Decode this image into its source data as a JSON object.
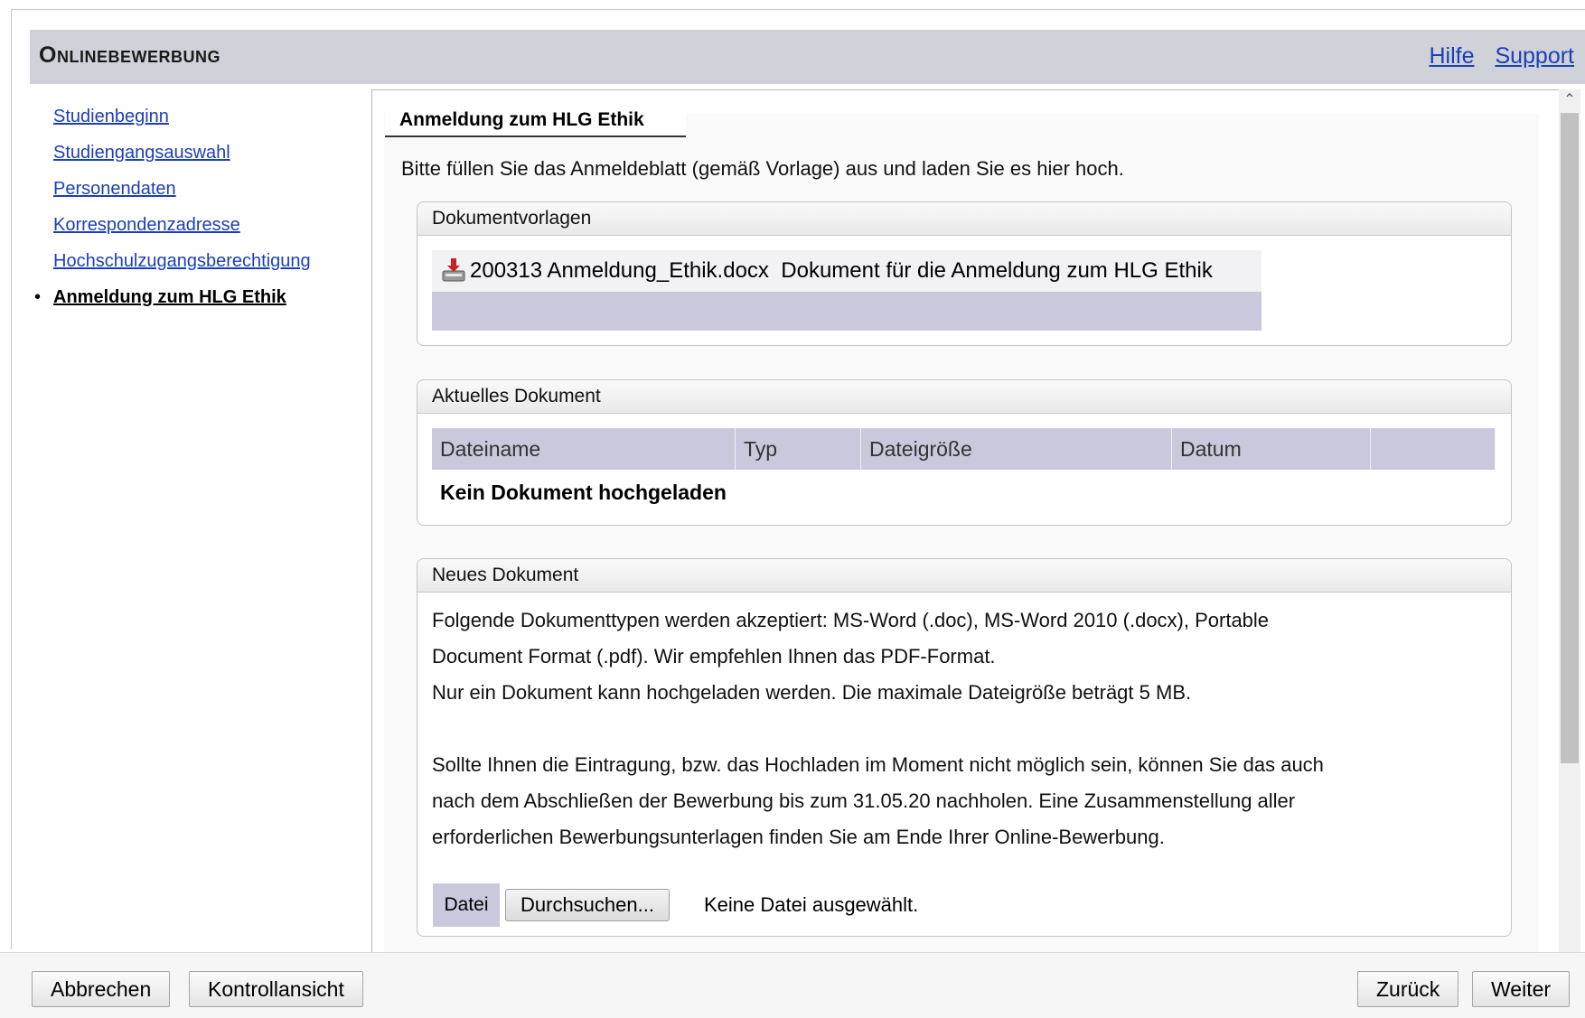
{
  "header": {
    "title": "Onlinebewerbung",
    "links": [
      "Hilfe",
      "Support"
    ]
  },
  "sidebar": {
    "items": [
      {
        "label": "Studienbeginn",
        "active": false
      },
      {
        "label": "Studiengangsauswahl",
        "active": false
      },
      {
        "label": "Personendaten",
        "active": false
      },
      {
        "label": "Korrespondenzadresse",
        "active": false
      },
      {
        "label": "Hochschulzugangsberechtigung",
        "active": false
      },
      {
        "label": "Anmeldung zum HLG Ethik",
        "active": true
      }
    ]
  },
  "page": {
    "tab_title": "Anmeldung zum HLG Ethik",
    "intro": "Bitte füllen Sie das Anmeldeblatt (gemäß Vorlage) aus und laden Sie es hier hoch."
  },
  "vorlagen": {
    "title": "Dokumentvorlagen",
    "file_name": "200313 Anmeldung_Ethik.docx",
    "file_desc": "Dokument für die Anmeldung zum HLG Ethik",
    "icon": "download-icon"
  },
  "aktuell": {
    "title": "Aktuelles Dokument",
    "columns": [
      "Dateiname",
      "Typ",
      "Dateigröße",
      "Datum",
      ""
    ],
    "empty_message": "Kein Dokument hochgeladen"
  },
  "neu": {
    "title": "Neues Dokument",
    "line1": "Folgende Dokumenttypen werden akzeptiert: MS-Word (.doc), MS-Word 2010 (.docx), Portable",
    "line2": "Document Format (.pdf). Wir empfehlen Ihnen das PDF-Format.",
    "line3": "Nur ein Dokument kann hochgeladen werden. Die maximale Dateigröße beträgt 5 MB.",
    "line4": "Sollte Ihnen die Eintragung, bzw. das Hochladen im Moment nicht möglich sein, können Sie das auch",
    "line5": "nach dem Abschließen der Bewerbung bis zum 31.05.20 nachholen. Eine Zusammenstellung aller",
    "line6": "erforderlichen Bewerbungsunterlagen finden Sie am Ende Ihrer Online-Bewerbung.",
    "file_label": "Datei",
    "browse_label": "Durchsuchen...",
    "no_file_text": "Keine Datei ausgewählt."
  },
  "footer": {
    "cancel": "Abbrechen",
    "review": "Kontrollansicht",
    "back": "Zurück",
    "next": "Weiter"
  },
  "colors": {
    "header_bg": "#cfd2d8",
    "link": "#1b3fb8",
    "table_header_bg": "#c9c8dd"
  }
}
